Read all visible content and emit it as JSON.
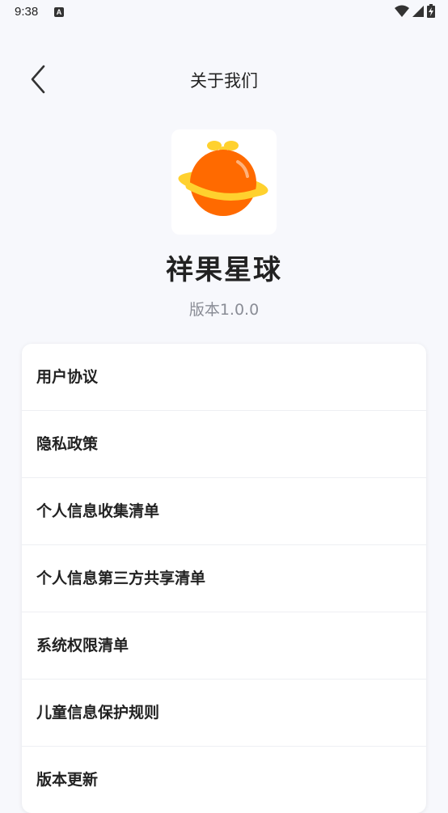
{
  "status_bar": {
    "time": "9:38",
    "notification_icon_letter": "A",
    "icons": [
      "wifi-icon",
      "signal-icon",
      "battery-charging-icon"
    ]
  },
  "header": {
    "title": "关于我们",
    "back_icon": "chevron-left-icon"
  },
  "app": {
    "name": "祥果星球",
    "version": "版本1.0.0",
    "logo_colors": {
      "planet": "#ff6a00",
      "ring": "#ffd12e"
    }
  },
  "menu": {
    "items": [
      {
        "label": "用户协议"
      },
      {
        "label": "隐私政策"
      },
      {
        "label": "个人信息收集清单"
      },
      {
        "label": "个人信息第三方共享清单"
      },
      {
        "label": "系统权限清单"
      },
      {
        "label": "儿童信息保护规则"
      },
      {
        "label": "版本更新"
      }
    ]
  }
}
